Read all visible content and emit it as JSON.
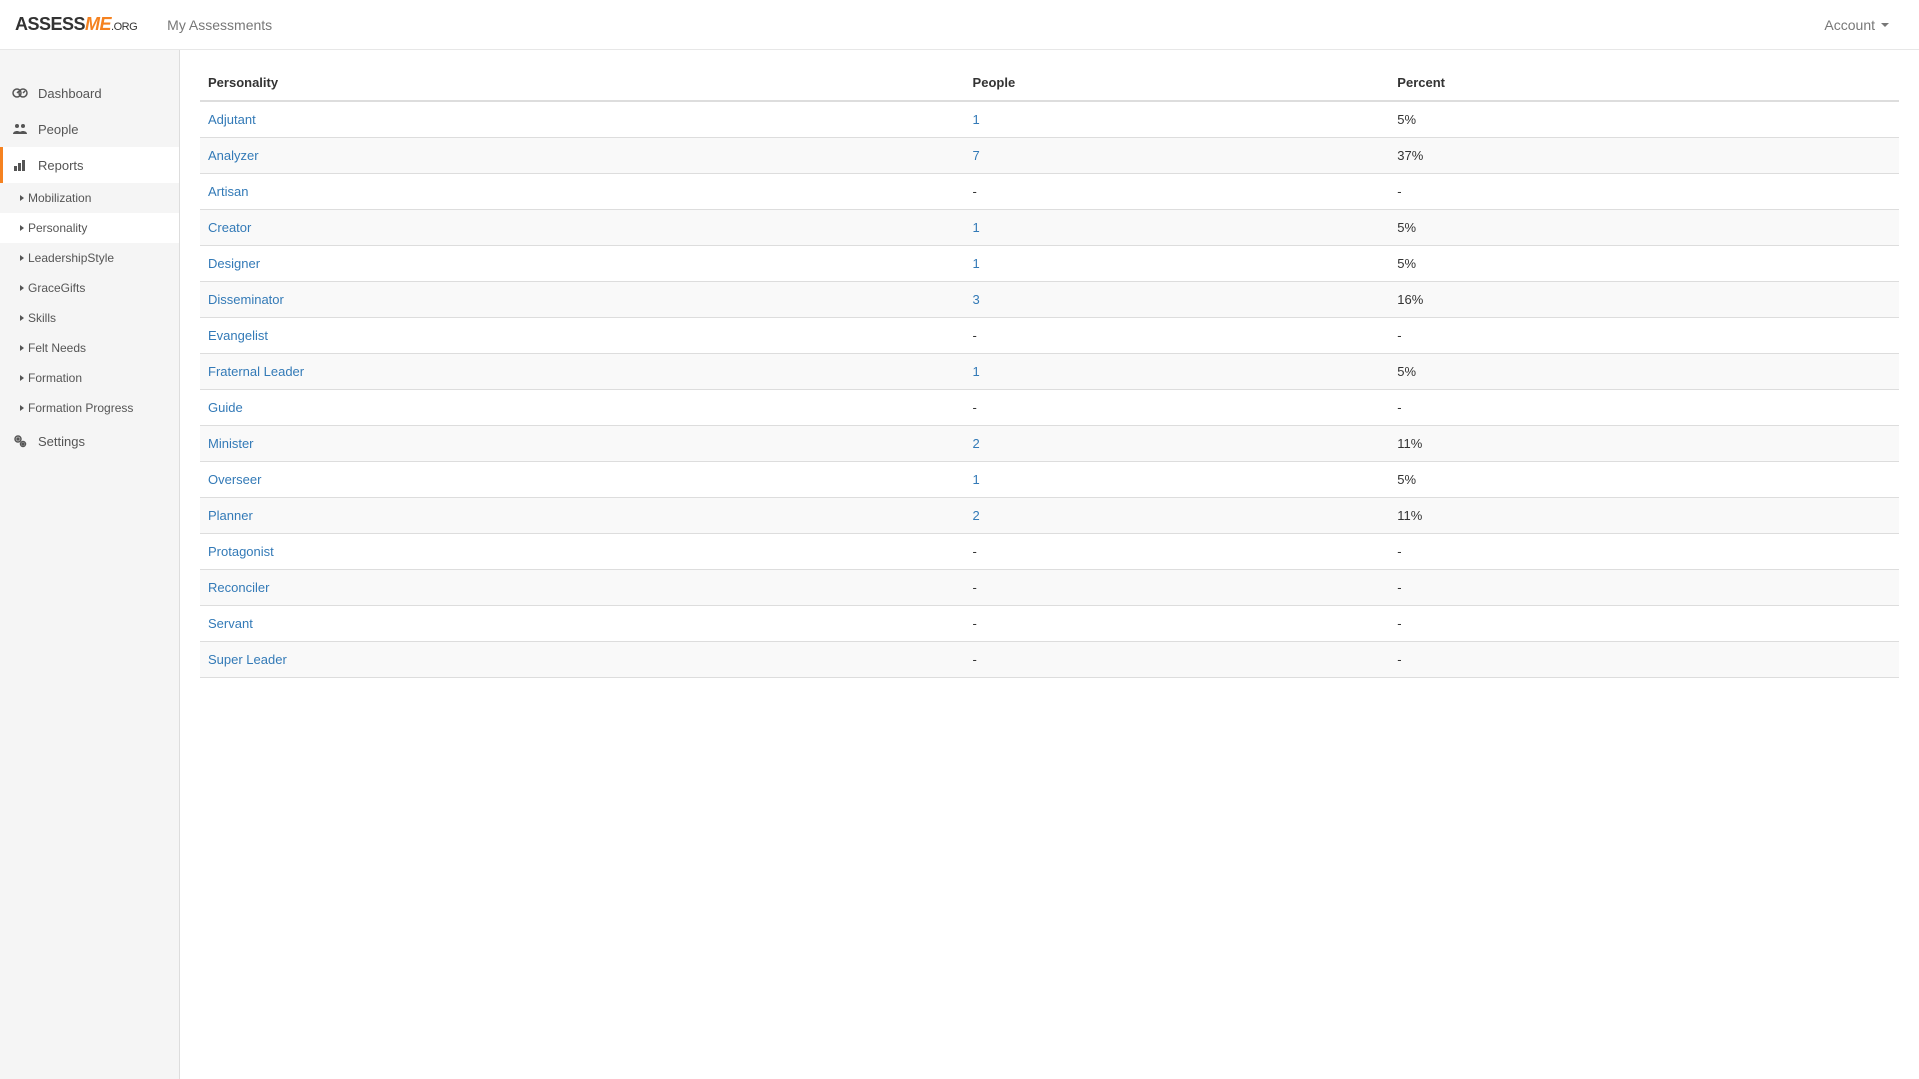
{
  "header": {
    "logo_assess": "ASSESS",
    "logo_me": "ME",
    "logo_org": ".ORG",
    "nav_my_assessments": "My Assessments",
    "account_label": "Account"
  },
  "sidebar": {
    "items": [
      {
        "label": "Dashboard",
        "icon": "dashboard-icon"
      },
      {
        "label": "People",
        "icon": "people-icon"
      },
      {
        "label": "Reports",
        "icon": "reports-icon"
      },
      {
        "label": "Settings",
        "icon": "settings-icon"
      }
    ],
    "subs": [
      {
        "label": "Mobilization"
      },
      {
        "label": "Personality"
      },
      {
        "label": "LeadershipStyle"
      },
      {
        "label": "GraceGifts"
      },
      {
        "label": "Skills"
      },
      {
        "label": "Felt Needs"
      },
      {
        "label": "Formation"
      },
      {
        "label": "Formation Progress"
      }
    ]
  },
  "table": {
    "headers": {
      "personality": "Personality",
      "people": "People",
      "percent": "Percent"
    },
    "rows": [
      {
        "personality": "Adjutant",
        "people": "1",
        "people_link": true,
        "percent": "5%"
      },
      {
        "personality": "Analyzer",
        "people": "7",
        "people_link": true,
        "percent": "37%"
      },
      {
        "personality": "Artisan",
        "people": "-",
        "people_link": false,
        "percent": "-"
      },
      {
        "personality": "Creator",
        "people": "1",
        "people_link": true,
        "percent": "5%"
      },
      {
        "personality": "Designer",
        "people": "1",
        "people_link": true,
        "percent": "5%"
      },
      {
        "personality": "Disseminator",
        "people": "3",
        "people_link": true,
        "percent": "16%"
      },
      {
        "personality": "Evangelist",
        "people": "-",
        "people_link": false,
        "percent": "-"
      },
      {
        "personality": "Fraternal Leader",
        "people": "1",
        "people_link": true,
        "percent": "5%"
      },
      {
        "personality": "Guide",
        "people": "-",
        "people_link": false,
        "percent": "-"
      },
      {
        "personality": "Minister",
        "people": "2",
        "people_link": true,
        "percent": "11%"
      },
      {
        "personality": "Overseer",
        "people": "1",
        "people_link": true,
        "percent": "5%"
      },
      {
        "personality": "Planner",
        "people": "2",
        "people_link": true,
        "percent": "11%"
      },
      {
        "personality": "Protagonist",
        "people": "-",
        "people_link": false,
        "percent": "-"
      },
      {
        "personality": "Reconciler",
        "people": "-",
        "people_link": false,
        "percent": "-"
      },
      {
        "personality": "Servant",
        "people": "-",
        "people_link": false,
        "percent": "-"
      },
      {
        "personality": "Super Leader",
        "people": "-",
        "people_link": false,
        "percent": "-"
      }
    ]
  }
}
